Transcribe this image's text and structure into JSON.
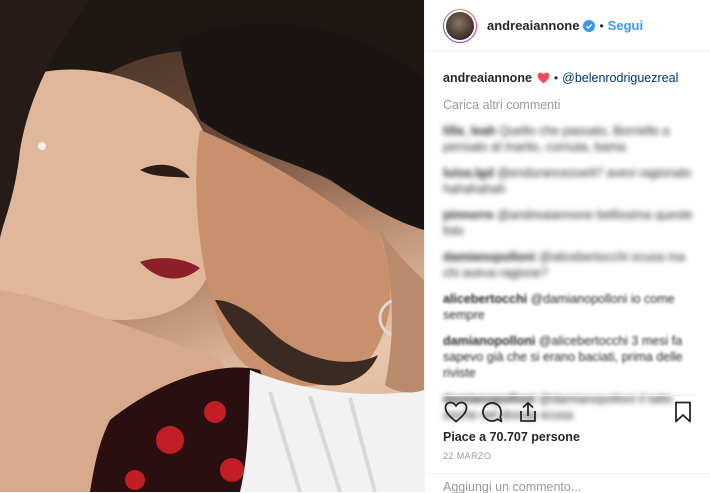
{
  "post": {
    "image_alt": "Foto del post",
    "username": "andreaiannone",
    "verified": true,
    "follow_label": "Segui",
    "caption": {
      "user": "andreaiannone",
      "mention": "@belenrodriguezreal"
    },
    "load_more_label": "Carica altri commenti",
    "comments": [
      {
        "user": "lilla_leah",
        "text": "Quello che passato, Borriello a pensato al marito, cornuta, bama"
      },
      {
        "user": "luisa.lgd",
        "text": "@endurancezoe97 avevi ragionato hahahahah"
      },
      {
        "user": "pinnorre",
        "text": "@andreaiannone bellissima queste foto"
      },
      {
        "user": "damianopolloni",
        "text": "@alicebertocchi scusa ma chi aveva ragione?"
      },
      {
        "user": "alicebertocchi",
        "text": "@damianopolloni io come sempre"
      },
      {
        "user": "damianopolloni",
        "text": "@alicebertocchi 3 mesi fa sapevo già che si erano baciati, prima delle riviste"
      },
      {
        "user": "damianopolloni",
        "text": "@damianopolloni il tatto anche nel dossip scusa"
      }
    ],
    "likes_label": "Piace a 70.707 persone",
    "date": "22 MARZO",
    "add_comment_placeholder": "Aggiungi un commento..."
  },
  "colors": {
    "accent": "#3897f0",
    "mention": "#003569",
    "muted": "#999999",
    "heart": "#ed4956"
  },
  "icons": [
    "verified-badge-icon",
    "red-heart-icon",
    "like-icon",
    "comment-icon",
    "share-icon",
    "save-icon"
  ]
}
